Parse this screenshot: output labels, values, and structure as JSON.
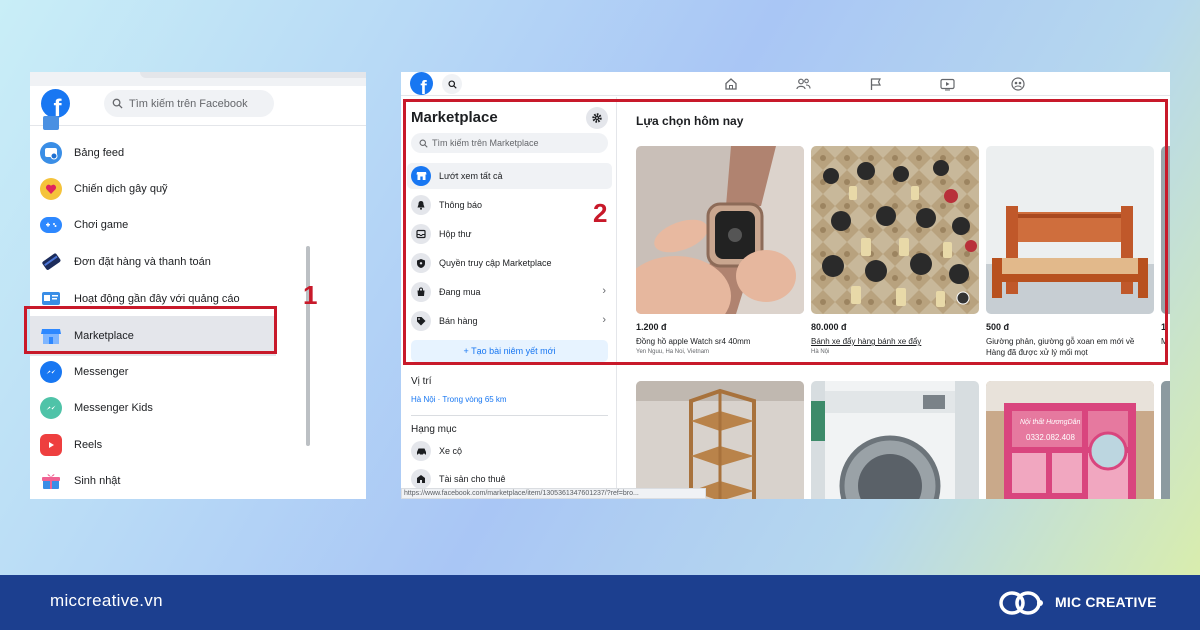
{
  "left_panel": {
    "search_placeholder": "Tìm kiếm trên Facebook",
    "items": [
      {
        "label": "Bảng feed",
        "icon": "feed-icon"
      },
      {
        "label": "Chiến dịch gây quỹ",
        "icon": "fundraiser-icon"
      },
      {
        "label": "Chơi game",
        "icon": "gaming-icon"
      },
      {
        "label": "Đơn đặt hàng và thanh toán",
        "icon": "orders-payments-icon"
      },
      {
        "label": "Hoạt động gần đây với quảng cáo",
        "icon": "ad-activity-icon"
      },
      {
        "label": "Marketplace",
        "icon": "marketplace-icon",
        "active": true
      },
      {
        "label": "Messenger",
        "icon": "messenger-icon"
      },
      {
        "label": "Messenger Kids",
        "icon": "messenger-kids-icon"
      },
      {
        "label": "Reels",
        "icon": "reels-icon"
      },
      {
        "label": "Sinh nhật",
        "icon": "birthday-icon"
      }
    ]
  },
  "annotations": {
    "step1": "1",
    "step2": "2"
  },
  "marketplace": {
    "title": "Marketplace",
    "search_placeholder": "Tìm kiếm trên Marketplace",
    "nav_items": [
      {
        "label": "Lướt xem tất cả",
        "icon": "browse-all-icon",
        "active": true
      },
      {
        "label": "Thông báo",
        "icon": "bell-icon"
      },
      {
        "label": "Hộp thư",
        "icon": "inbox-icon"
      },
      {
        "label": "Quyền truy cập Marketplace",
        "icon": "access-shield-icon"
      },
      {
        "label": "Đang mua",
        "icon": "buying-bag-icon",
        "has_chevron": true
      },
      {
        "label": "Bán hàng",
        "icon": "selling-tag-icon",
        "has_chevron": true
      }
    ],
    "create_listing": "+ Tạo bài niêm yết mới",
    "location_title": "Vị trí",
    "location_value": "Hà Nội · Trong vòng 65 km",
    "categories_title": "Hạng mục",
    "categories": [
      {
        "label": "Xe cộ",
        "icon": "car-icon"
      },
      {
        "label": "Tài sản cho thuê",
        "icon": "rental-icon"
      }
    ],
    "section_title": "Lựa chọn hôm nay",
    "listings": [
      {
        "price": "1.200 đ",
        "title": "Đồng hồ apple Watch sr4 40mm",
        "location": "Yen Nguu, Ha Noi, Vietnam",
        "underline": false
      },
      {
        "price": "80.000 đ",
        "title": "Bánh xe đẩy hàng bánh xe đẩy",
        "location": "Hà Nội",
        "underline": true
      },
      {
        "price": "500 đ",
        "title": "Giường phản, giường gỗ xoan em mới về Hàng đã được xử lý mối mọt",
        "location": "",
        "underline": false
      },
      {
        "price": "1",
        "title": "M",
        "location": "",
        "underline": false
      }
    ],
    "status_url": "https://www.facebook.com/marketplace/item/1305361347601237/?ref=bro..."
  },
  "product_overlays": {
    "cabinet_text_1": "Nội thất HươngDân",
    "cabinet_text_2": "0332.082.408"
  },
  "footer": {
    "url": "miccreative.vn",
    "brand": "MIC CREATIVE"
  },
  "colors": {
    "facebook_blue": "#1877f2",
    "highlight_red": "#c8192a",
    "footer_navy": "#1c3f8f"
  }
}
